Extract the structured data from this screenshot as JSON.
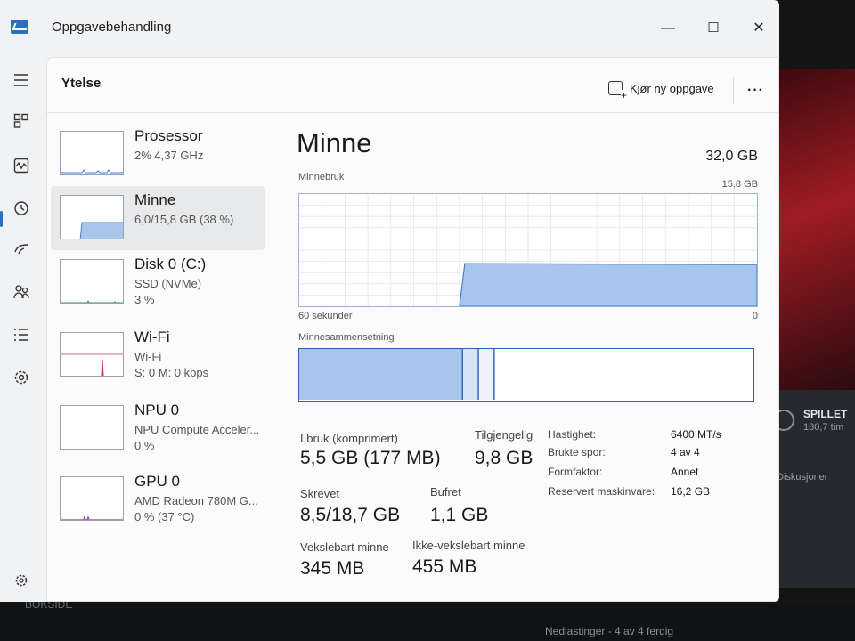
{
  "window": {
    "title": "Oppgavebehandling",
    "minimize": "—",
    "maximize": "☐",
    "close": "✕"
  },
  "header": {
    "section": "Ytelse",
    "new_task": "Kjør ny oppgave",
    "more": "···"
  },
  "devices": [
    {
      "name": "Prosessor",
      "sub1": "2%  4,37 GHz",
      "sub2": ""
    },
    {
      "name": "Minne",
      "sub1": "6,0/15,8 GB (38 %)",
      "sub2": ""
    },
    {
      "name": "Disk 0 (C:)",
      "sub1": "SSD (NVMe)",
      "sub2": "3 %"
    },
    {
      "name": "Wi-Fi",
      "sub1": "Wi-Fi",
      "sub2": "S: 0  M: 0 kbps"
    },
    {
      "name": "NPU 0",
      "sub1": "NPU Compute Acceler...",
      "sub2": "0 %"
    },
    {
      "name": "GPU 0",
      "sub1": "AMD Radeon 780M G...",
      "sub2": "0 % (37 °C)"
    }
  ],
  "memory": {
    "title": "Minne",
    "total": "32,0 GB",
    "usage_label": "Minnebruk",
    "usage_max": "15,8 GB",
    "x_left": "60 sekunder",
    "x_right": "0",
    "usage_fraction": 0.38,
    "composition_label": "Minnesammensetning",
    "composition": {
      "in_use_fraction": 0.36,
      "modified_fraction": 0.035,
      "standby_fraction": 0.035
    },
    "stats": {
      "in_use_label": "I bruk (komprimert)",
      "in_use_value": "5,5 GB (177 MB)",
      "available_label": "Tilgjengelig",
      "available_value": "9,8 GB",
      "committed_label": "Skrevet",
      "committed_value": "8,5/18,7 GB",
      "cached_label": "Bufret",
      "cached_value": "1,1 GB",
      "paged_label": "Vekslebart minne",
      "paged_value": "345 MB",
      "nonpaged_label": "Ikke-vekslebart minne",
      "nonpaged_value": "455 MB"
    },
    "specs": {
      "speed_label": "Hastighet:",
      "speed_value": "6400 MT/s",
      "slots_label": "Brukte spor:",
      "slots_value": "4 av 4",
      "form_label": "Formfaktor:",
      "form_value": "Annet",
      "reserved_label": "Reservert maskinvare:",
      "reserved_value": "16,2 GB"
    }
  },
  "background": {
    "game_title": "SPILLET",
    "game_time": "180,7 tim",
    "discussions": "Diskusjoner",
    "downloads": "Nedlastinger - 4 av 4 ferdig",
    "left_text": "BOKSIDE"
  },
  "colors": {
    "accent": "#2b6fc4",
    "graph_fill": "#a8c6ec",
    "graph_line": "#4d7fc8",
    "graph_border": "#9ab4d6"
  }
}
